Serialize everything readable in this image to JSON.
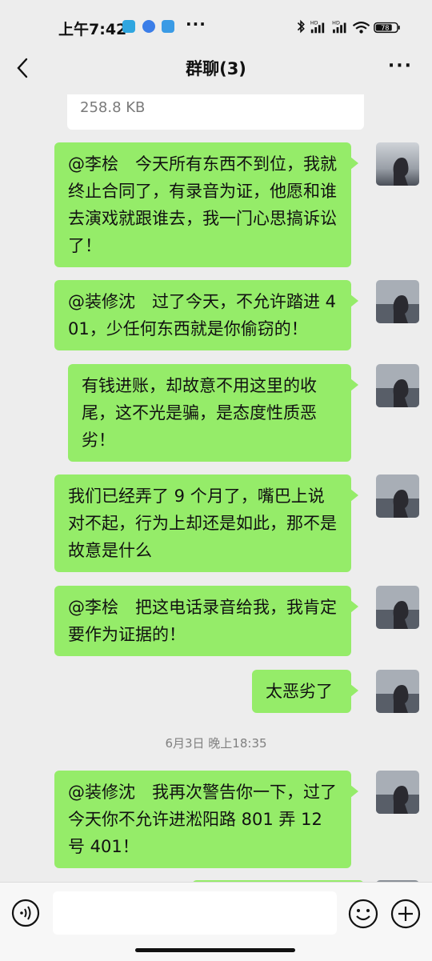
{
  "status_bar": {
    "time": "上午7:42",
    "dots": "···",
    "battery": "78"
  },
  "header": {
    "title": "群聊(3)",
    "more": "···"
  },
  "file_card": {
    "size": "258.8 KB"
  },
  "messages": [
    {
      "text": "@李桧　今天所有东西不到位，我就终止合同了，有录音为证，他愿和谁去演戏就跟谁去，我一门心思搞诉讼了！"
    },
    {
      "text": "@装修沈　过了今天，不允许踏进 401，少任何东西就是你偷窃的！"
    },
    {
      "text": "有钱进账，却故意不用这里的收尾，这不光是骗，是态度性质恶劣！"
    },
    {
      "text": "我们已经弄了 9 个月了，嘴巴上说对不起，行为上却还是如此，那不是故意是什么"
    },
    {
      "text": "@李桧　把这电话录音给我，我肯定要作为证据的！"
    },
    {
      "text": "太恶劣了"
    },
    {
      "text": "@装修沈　我再次警告你一下，过了今天你不允许进淞阳路 801 弄 12 号 401！"
    }
  ],
  "timestamp": "6月3日 晚上18:35",
  "input": {
    "placeholder": ""
  },
  "colors": {
    "background": "#ededed",
    "bubble": "#95ec69"
  }
}
